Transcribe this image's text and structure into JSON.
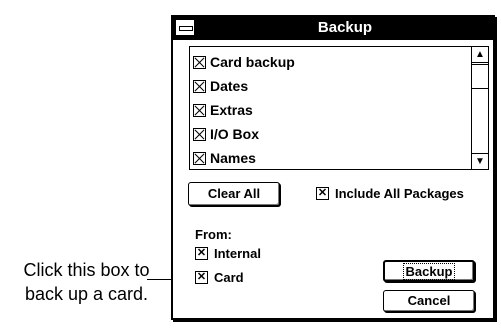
{
  "callout": {
    "line1": "Click this box to",
    "line2": "back up a card."
  },
  "window": {
    "title": "Backup",
    "list_items": [
      {
        "label": "Card backup",
        "checked": true
      },
      {
        "label": "Dates",
        "checked": true
      },
      {
        "label": "Extras",
        "checked": true
      },
      {
        "label": "I/O Box",
        "checked": true
      },
      {
        "label": "Names",
        "checked": true
      }
    ],
    "clear_all_label": "Clear All",
    "include_all_label": "Include All Packages",
    "include_all_checked": true,
    "from_label": "From:",
    "internal_label": "Internal",
    "internal_checked": true,
    "card_label": "Card",
    "card_checked": true,
    "backup_label": "Backup",
    "cancel_label": "Cancel"
  },
  "icons": {
    "system_menu": "system-menu-icon",
    "scroll_up": "scroll-up-arrow-icon",
    "scroll_down": "scroll-down-arrow-icon"
  }
}
